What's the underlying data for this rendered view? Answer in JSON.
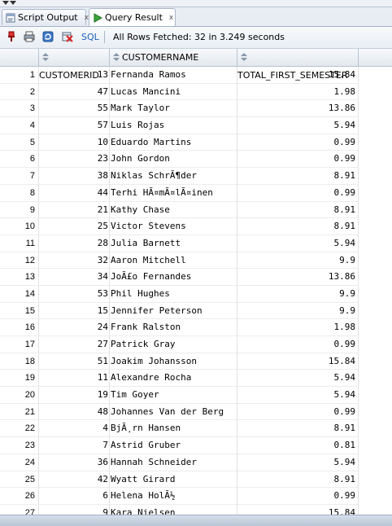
{
  "tabs": [
    {
      "label": "Script Output",
      "icon": "script-output-icon",
      "close": "x"
    },
    {
      "label": "Query Result",
      "icon": "run-query-icon",
      "close": "x"
    }
  ],
  "toolbar": {
    "sql_label": "SQL",
    "status": "All Rows Fetched: 32 in 3.249 seconds",
    "icons": [
      "pin-icon",
      "print-icon",
      "refresh-icon",
      "clear-icon"
    ]
  },
  "columns": [
    "CUSTOMERID",
    "CUSTOMERNAME",
    "TOTAL_FIRST_SEMESTER"
  ],
  "rows": [
    [
      "1",
      "13",
      "Fernanda Ramos",
      "15.84"
    ],
    [
      "2",
      "47",
      "Lucas Mancini",
      "1.98"
    ],
    [
      "3",
      "55",
      "Mark Taylor",
      "13.86"
    ],
    [
      "4",
      "57",
      "Luis Rojas",
      "5.94"
    ],
    [
      "5",
      "10",
      "Eduardo Martins",
      "0.99"
    ],
    [
      "6",
      "23",
      "John Gordon",
      "0.99"
    ],
    [
      "7",
      "38",
      "Niklas SchrÃ¶der",
      "8.91"
    ],
    [
      "8",
      "44",
      "Terhi HÃ¤mÃ¤lÃ¤inen",
      "0.99"
    ],
    [
      "9",
      "21",
      "Kathy Chase",
      "8.91"
    ],
    [
      "10",
      "25",
      "Victor Stevens",
      "8.91"
    ],
    [
      "11",
      "28",
      "Julia Barnett",
      "5.94"
    ],
    [
      "12",
      "32",
      "Aaron Mitchell",
      "9.9"
    ],
    [
      "13",
      "34",
      "JoÃ£o Fernandes",
      "13.86"
    ],
    [
      "14",
      "53",
      "Phil Hughes",
      "9.9"
    ],
    [
      "15",
      "15",
      "Jennifer Peterson",
      "9.9"
    ],
    [
      "16",
      "24",
      "Frank Ralston",
      "1.98"
    ],
    [
      "17",
      "27",
      "Patrick Gray",
      "0.99"
    ],
    [
      "18",
      "51",
      "Joakim Johansson",
      "15.84"
    ],
    [
      "19",
      "11",
      "Alexandre Rocha",
      "5.94"
    ],
    [
      "20",
      "19",
      "Tim Goyer",
      "5.94"
    ],
    [
      "21",
      "48",
      "Johannes Van der Berg",
      "0.99"
    ],
    [
      "22",
      "4",
      "BjÃ¸rn Hansen",
      "8.91"
    ],
    [
      "23",
      "7",
      "Astrid Gruber",
      "0.81"
    ],
    [
      "24",
      "36",
      "Hannah Schneider",
      "5.94"
    ],
    [
      "25",
      "42",
      "Wyatt Girard",
      "8.91"
    ],
    [
      "26",
      "6",
      "Helena HolÃ½",
      "0.99"
    ],
    [
      "27",
      "9",
      "Kara Nielsen",
      "15.84"
    ]
  ]
}
